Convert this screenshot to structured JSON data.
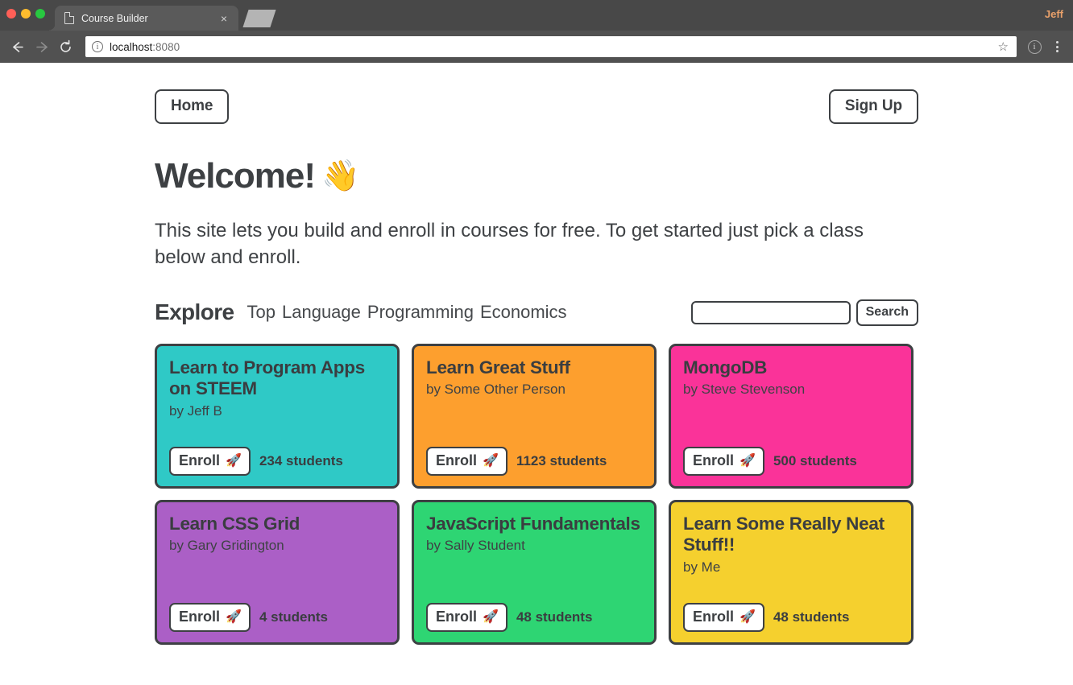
{
  "browser": {
    "tab_title": "Course Builder",
    "tab_close_label": "×",
    "profile_name": "Jeff",
    "url_scheme_text": "localhost",
    "url_rest_text": ":8080",
    "back_icon": "back-arrow-icon",
    "forward_icon": "forward-arrow-icon",
    "reload_icon": "reload-icon",
    "info_icon": "ⓘ",
    "star_icon": "☆"
  },
  "nav": {
    "home_label": "Home",
    "signup_label": "Sign Up"
  },
  "hero": {
    "heading": "Welcome!",
    "wave_emoji": "👋",
    "paragraph": "This site lets you build and enroll in courses for free. To get started just pick a class below and enroll."
  },
  "explore": {
    "title": "Explore",
    "categories": [
      {
        "label": "Top"
      },
      {
        "label": "Language"
      },
      {
        "label": "Programming"
      },
      {
        "label": "Economics"
      }
    ],
    "search": {
      "value": "",
      "placeholder": "",
      "button_label": "Search"
    }
  },
  "courses": {
    "enroll_label": "Enroll",
    "rocket_emoji": "🚀",
    "items": [
      {
        "title": "Learn to Program Apps on STEEM",
        "author": "by Jeff B",
        "students": "234 students",
        "color": "#2FC9C6"
      },
      {
        "title": "Learn Great Stuff",
        "author": "by Some Other Person",
        "students": "1123 students",
        "color": "#FD9F2E"
      },
      {
        "title": "MongoDB",
        "author": "by Steve Stevenson",
        "students": "500 students",
        "color": "#FA3399"
      },
      {
        "title": "Learn CSS Grid",
        "author": "by Gary Gridington",
        "students": "4 students",
        "color": "#AB5FC6"
      },
      {
        "title": "JavaScript Fundamentals",
        "author": "by Sally Student",
        "students": "48 students",
        "color": "#2ED573"
      },
      {
        "title": "Learn Some Really Neat Stuff!!",
        "author": "by Me",
        "students": "48 students",
        "color": "#F5D02E"
      }
    ]
  },
  "theme": {
    "ink": "#3d4043",
    "chrome_tabstrip": "#484848",
    "chrome_toolbar": "#515151"
  }
}
